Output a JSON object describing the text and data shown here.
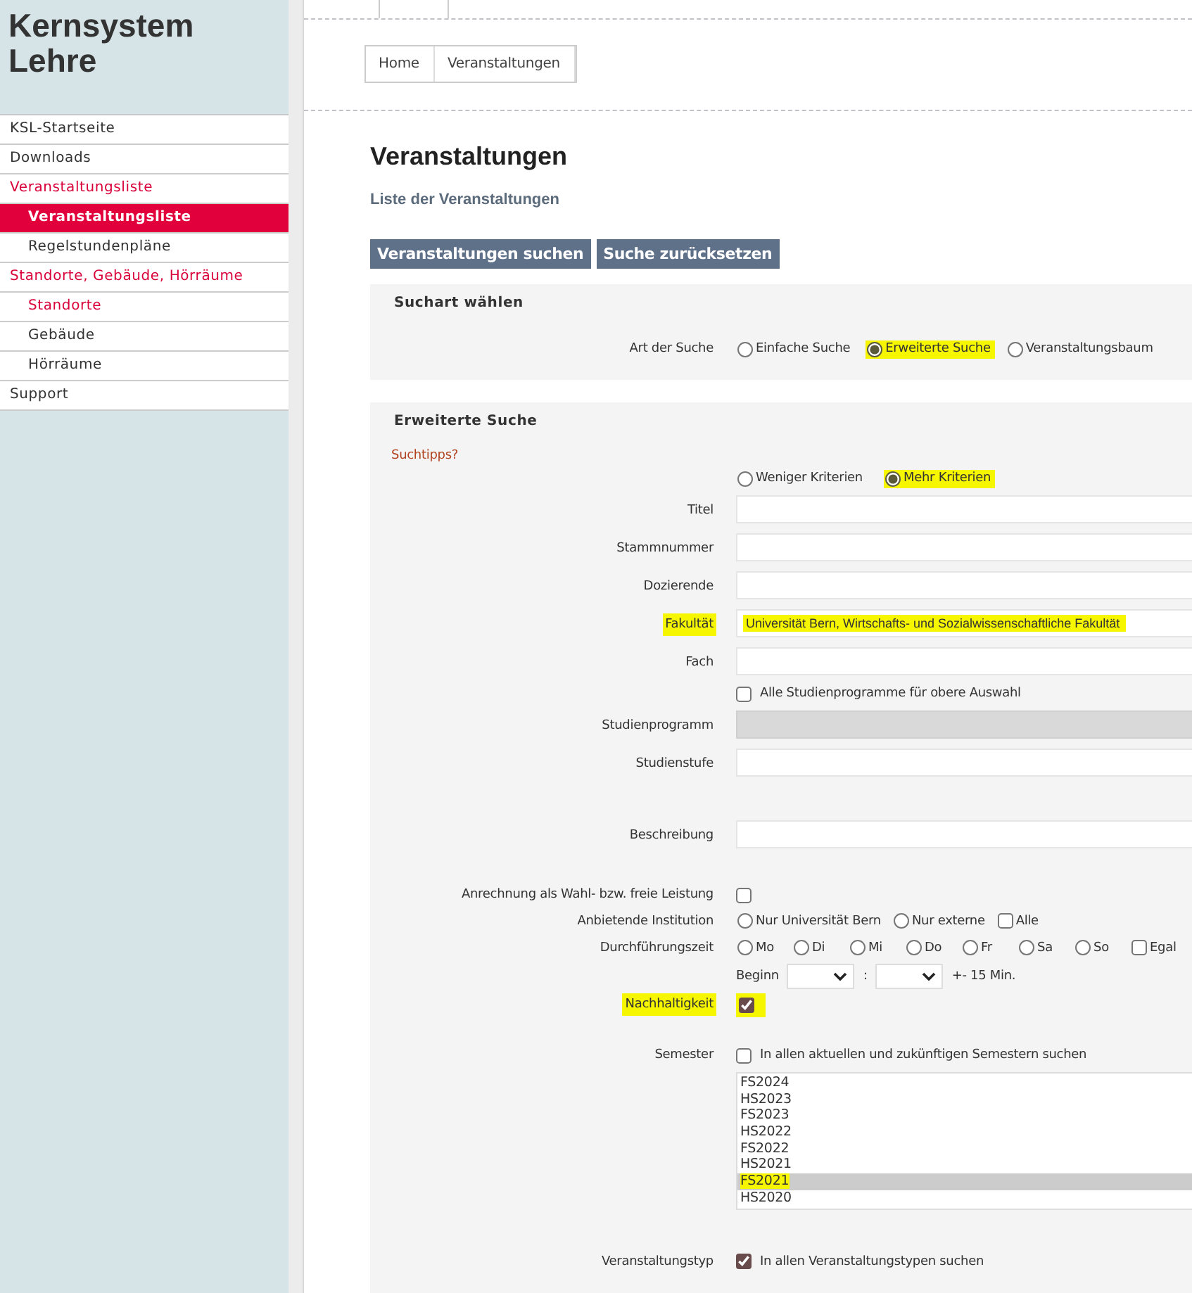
{
  "sidebar": {
    "title": "Kernsystem Lehre",
    "items": [
      {
        "label": "KSL-Startseite",
        "active": false,
        "selected": false
      },
      {
        "label": "Downloads",
        "active": false,
        "selected": false
      },
      {
        "label": "Veranstaltungsliste",
        "active": true,
        "selected": false,
        "children": [
          {
            "label": "Veranstaltungsliste",
            "active": true,
            "selected": true
          },
          {
            "label": "Regelstundenpläne",
            "active": false,
            "selected": false
          }
        ]
      },
      {
        "label": "Standorte, Gebäude, Hörräume",
        "active": true,
        "selected": false,
        "children": [
          {
            "label": "Standorte",
            "active": true,
            "selected": false
          },
          {
            "label": "Gebäude",
            "active": false,
            "selected": false
          },
          {
            "label": "Hörräume",
            "active": false,
            "selected": false
          }
        ]
      },
      {
        "label": "Support",
        "active": false,
        "selected": false
      }
    ]
  },
  "breadcrumb": [
    "Home",
    "Veranstaltungen"
  ],
  "page": {
    "title": "Veranstaltungen",
    "subtitle": "Liste der Veranstaltungen"
  },
  "buttons": [
    "Veranstaltungen suchen",
    "Suche zurücksetzen"
  ],
  "search_type": {
    "legend": "Suchart wählen",
    "label": "Art der Suche",
    "options": [
      {
        "text": "Einfache Suche",
        "selected": false,
        "highlighted": false
      },
      {
        "text": "Erweiterte Suche",
        "selected": true,
        "highlighted": true
      },
      {
        "text": "Veranstaltungsbaum",
        "selected": false,
        "highlighted": false
      }
    ]
  },
  "advanced": {
    "legend": "Erweiterte Suche",
    "help_link": "Suchtipps?",
    "criteria": [
      {
        "text": "Weniger Kriterien",
        "selected": false,
        "highlighted": false
      },
      {
        "text": "Mehr Kriterien",
        "selected": true,
        "highlighted": true
      }
    ],
    "fields": [
      {
        "kind": "text",
        "label": "Titel",
        "disabled": false,
        "highlighted": false
      },
      {
        "kind": "text",
        "label": "Stammnummer",
        "disabled": false,
        "highlighted": false
      },
      {
        "kind": "text",
        "label": "Dozierende",
        "disabled": false,
        "highlighted": false
      },
      {
        "kind": "text",
        "label": "Fakultät",
        "value": "Universität Bern, Wirtschafts- und Sozialwissenschaftliche Fakultät",
        "disabled": false,
        "highlighted": true
      },
      {
        "kind": "text",
        "label": "Fach",
        "disabled": false,
        "highlighted": false
      },
      {
        "kind": "checkbox",
        "text": "Alle Studienprogramme für obere Auswahl",
        "checked": false
      },
      {
        "kind": "text",
        "label": "Studienprogramm",
        "disabled": true,
        "highlighted": false
      },
      {
        "kind": "text",
        "label": "Studienstufe",
        "disabled": false,
        "highlighted": false
      },
      {
        "kind": "text",
        "label": "Beschreibung",
        "disabled": false,
        "highlighted": false
      },
      {
        "kind": "checkbox",
        "label": "Anrechnung als Wahl- bzw. freie Leistung",
        "checked": false
      },
      {
        "kind": "options",
        "label": "Anbietende Institution",
        "options": [
          {
            "kind": "radio",
            "text": "Nur Universität Bern",
            "checked": false
          },
          {
            "kind": "radio",
            "text": "Nur externe",
            "checked": false
          },
          {
            "kind": "checkbox",
            "text": "Alle",
            "checked": false
          }
        ]
      },
      {
        "kind": "options",
        "label": "Durchführungszeit",
        "options": [
          {
            "kind": "radio",
            "text": "Mo",
            "checked": false
          },
          {
            "kind": "radio",
            "text": "Di",
            "checked": false
          },
          {
            "kind": "radio",
            "text": "Mi",
            "checked": false
          },
          {
            "kind": "radio",
            "text": "Do",
            "checked": false
          },
          {
            "kind": "radio",
            "text": "Fr",
            "checked": false
          },
          {
            "kind": "radio",
            "text": "Sa",
            "checked": false
          },
          {
            "kind": "radio",
            "text": "So",
            "checked": false
          },
          {
            "kind": "checkbox",
            "text": "Egal",
            "checked": false
          }
        ]
      },
      {
        "kind": "time",
        "text": "Beginn",
        "separator": ":",
        "suffix": "+- 15 Min."
      },
      {
        "kind": "checkbox",
        "label": "Nachhaltigkeit",
        "checked": true,
        "highlighted": true
      },
      {
        "kind": "checkbox",
        "label": "Semester",
        "text": "In allen aktuellen und zukünftigen Semestern suchen",
        "checked": false
      },
      {
        "kind": "listbox",
        "items": [
          {
            "text": "FS2024",
            "selected": false,
            "highlighted": false
          },
          {
            "text": "HS2023",
            "selected": false,
            "highlighted": false
          },
          {
            "text": "FS2023",
            "selected": false,
            "highlighted": false
          },
          {
            "text": "HS2022",
            "selected": false,
            "highlighted": false
          },
          {
            "text": "FS2022",
            "selected": false,
            "highlighted": false
          },
          {
            "text": "HS2021",
            "selected": false,
            "highlighted": false
          },
          {
            "text": "FS2021",
            "selected": true,
            "highlighted": true
          },
          {
            "text": "HS2020",
            "selected": false,
            "highlighted": false
          }
        ]
      },
      {
        "kind": "checkbox",
        "label": "Veranstaltungstyp",
        "text": "In allen Veranstaltungstypen suchen",
        "checked": true
      }
    ]
  }
}
